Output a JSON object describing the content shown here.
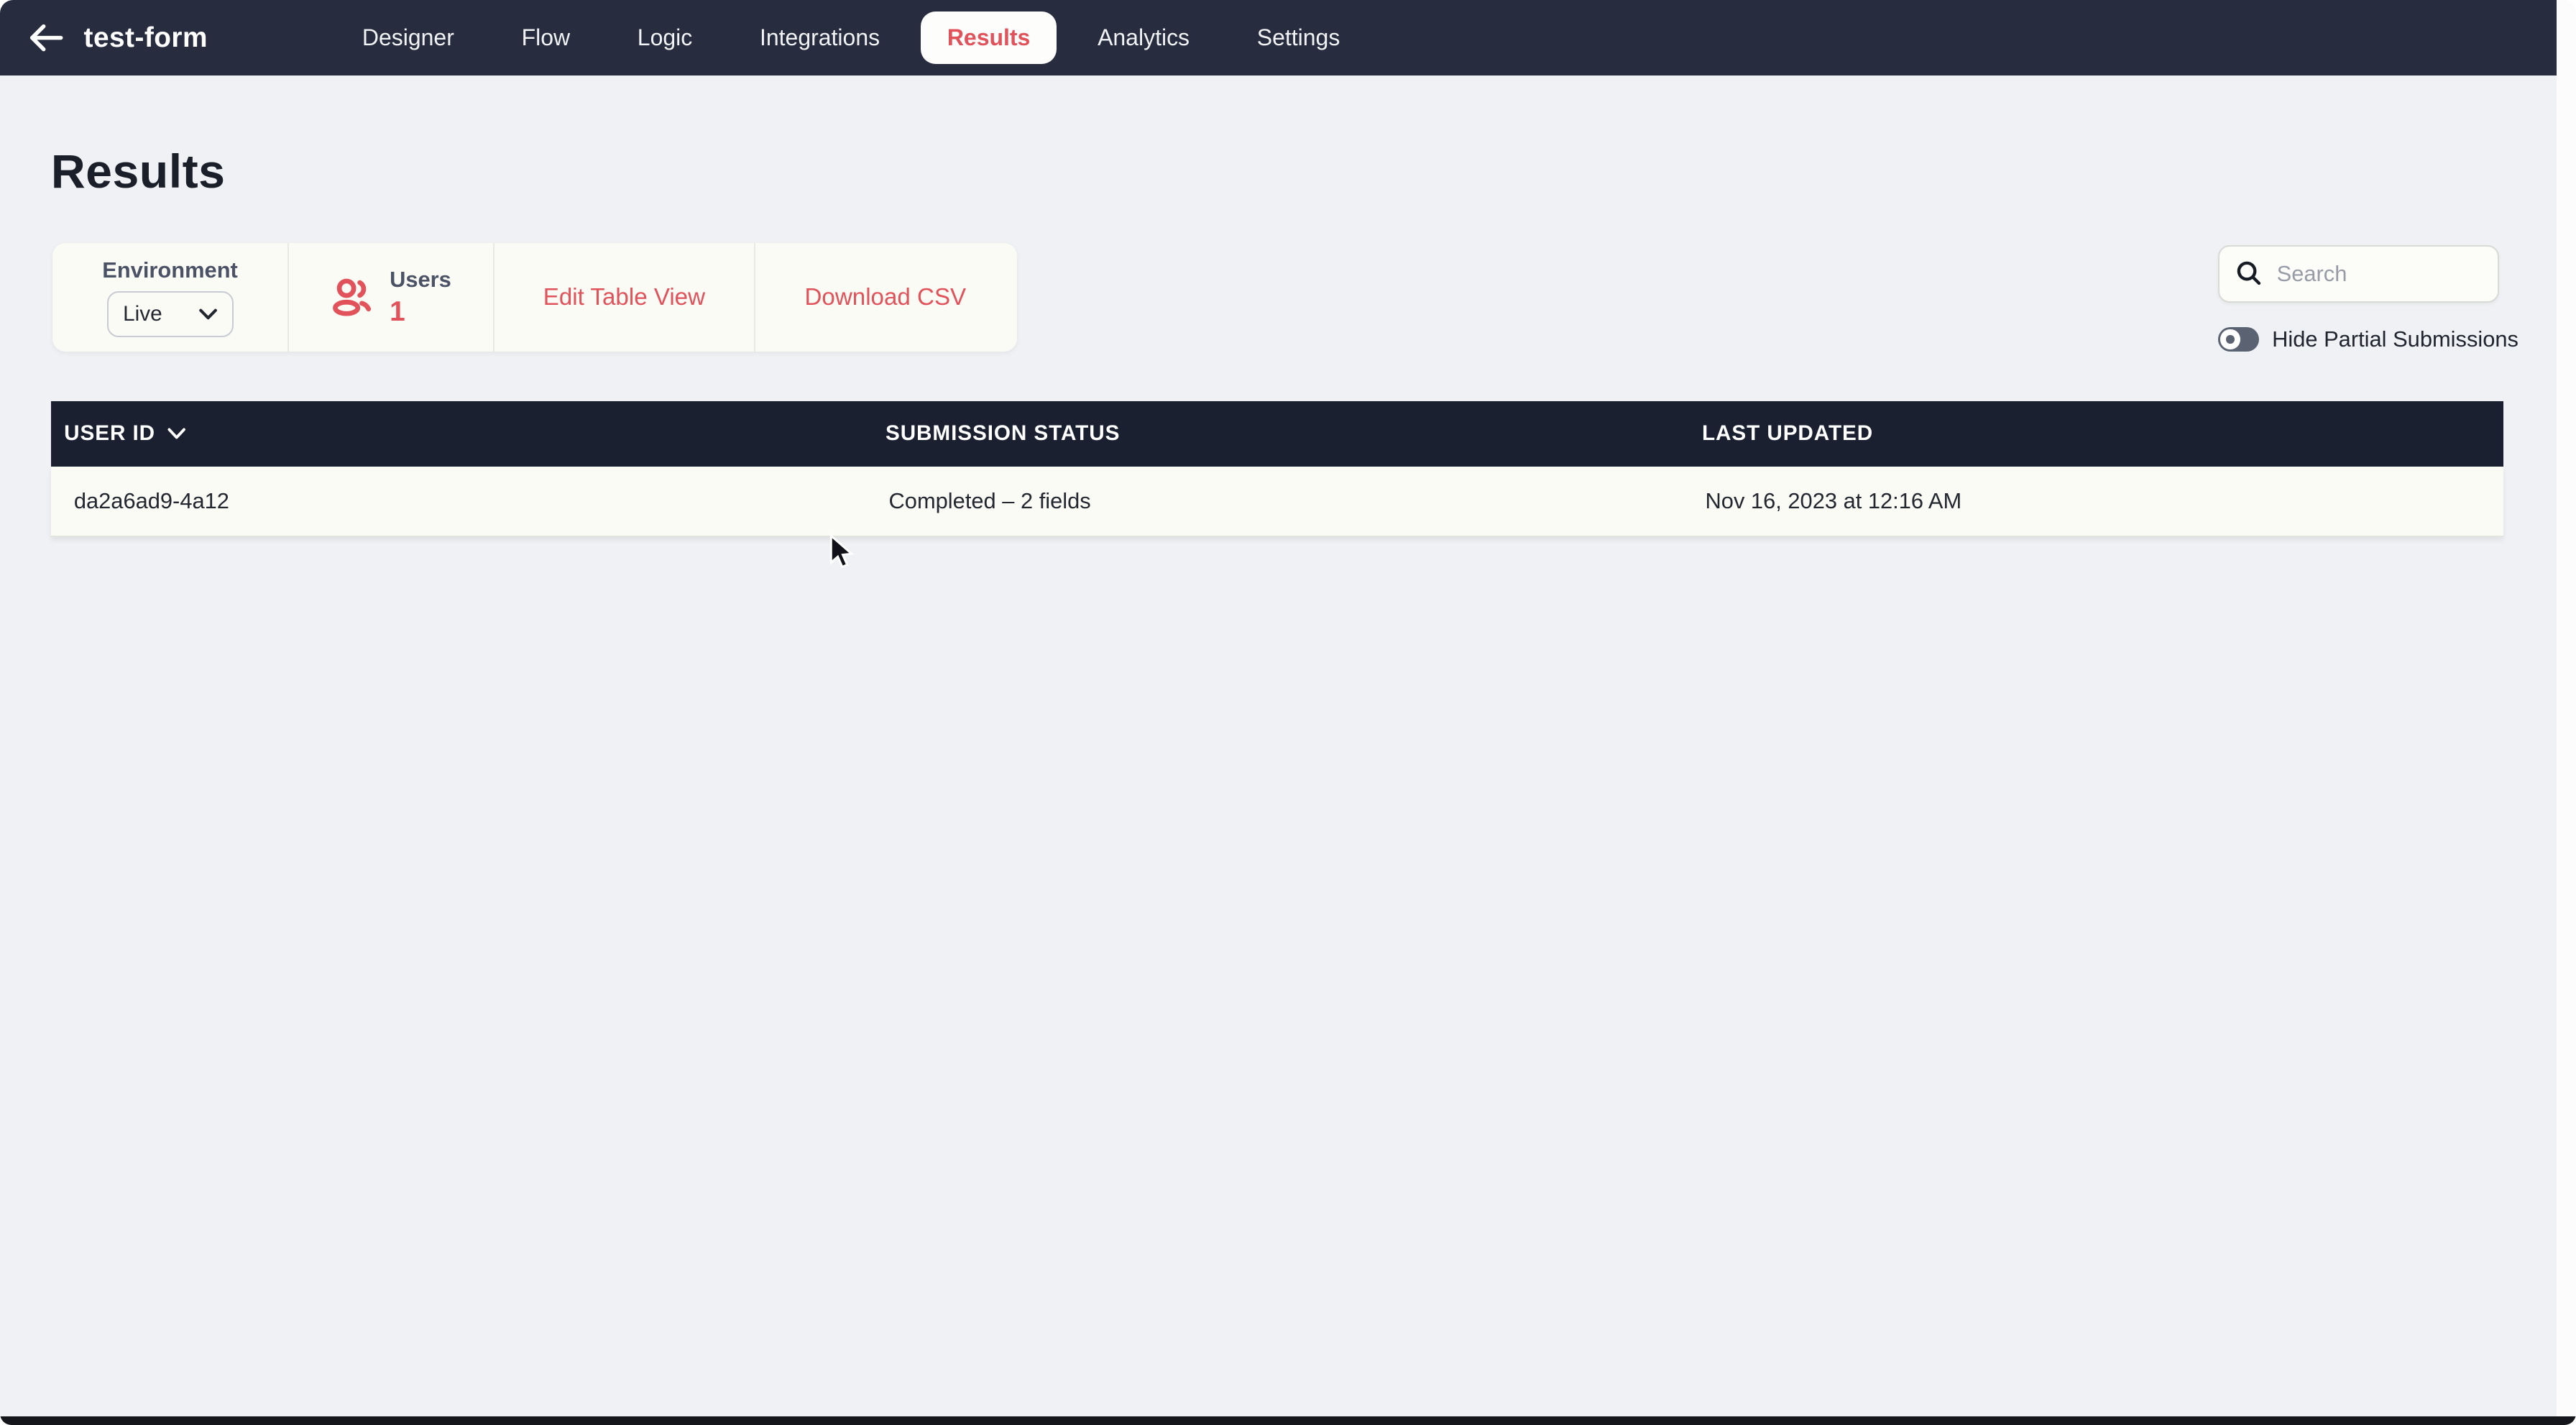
{
  "colors": {
    "accent": "#e1525a",
    "nav_bg": "#272c3f",
    "table_header_bg": "#1b2031",
    "page_bg": "#eff1f4",
    "card_bg": "#fbfbf6",
    "toggle_off_bg": "#5b6372"
  },
  "nav": {
    "back_icon": "arrow-left-icon",
    "title": "test-form",
    "tabs": [
      {
        "label": "Designer",
        "active": false
      },
      {
        "label": "Flow",
        "active": false
      },
      {
        "label": "Logic",
        "active": false
      },
      {
        "label": "Integrations",
        "active": false
      },
      {
        "label": "Results",
        "active": true
      },
      {
        "label": "Analytics",
        "active": false
      },
      {
        "label": "Settings",
        "active": false
      }
    ]
  },
  "page": {
    "title": "Results"
  },
  "toolbar": {
    "environment": {
      "label": "Environment",
      "selected": "Live"
    },
    "users": {
      "label": "Users",
      "count": "1",
      "icon": "users-icon"
    },
    "edit_table_view_label": "Edit Table View",
    "download_csv_label": "Download CSV"
  },
  "search": {
    "placeholder": "Search",
    "icon": "search-icon",
    "value": ""
  },
  "filters": {
    "hide_partial_label": "Hide Partial Submissions",
    "toggle_on": false
  },
  "table": {
    "columns": [
      "USER ID",
      "SUBMISSION STATUS",
      "LAST UPDATED"
    ],
    "sort_column": "USER ID",
    "rows": [
      {
        "user_id": "da2a6ad9-4a12",
        "status": "Completed – 2 fields",
        "last_updated": "Nov 16, 2023 at 12:16 AM"
      }
    ]
  }
}
